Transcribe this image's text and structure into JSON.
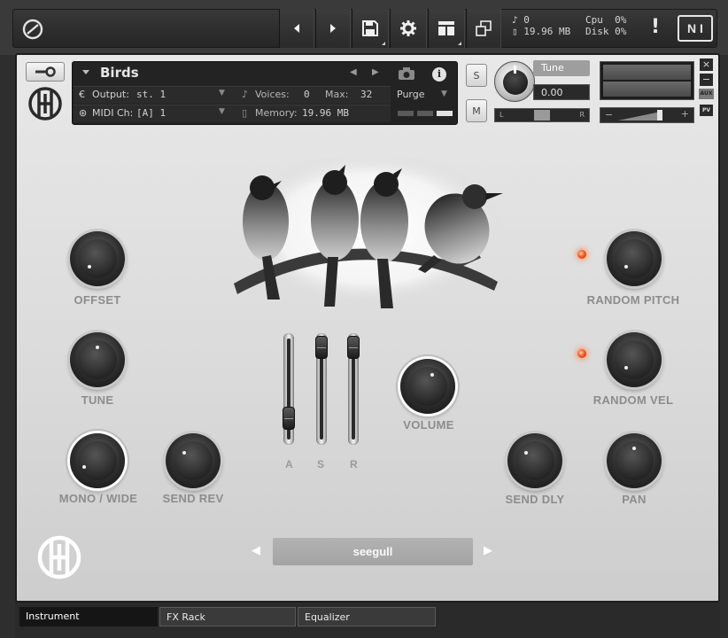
{
  "toolbar": {
    "logo_icon": "kontakt-logo-icon",
    "prev_icon": "triangle-left-icon",
    "next_icon": "triangle-right-icon",
    "voices": "0",
    "memory": "19.96 MB",
    "cpu_label": "Cpu",
    "cpu_value": "0%",
    "disk_label": "Disk",
    "disk_value": "0%",
    "warning": "!",
    "ni_logo": "N I"
  },
  "instrument": {
    "name": "Birds",
    "output_label": "Output:",
    "output_value": "st. 1",
    "voices_label": "Voices:",
    "voices_value": "0",
    "max_label": "Max:",
    "max_value": "32",
    "purge_label": "Purge",
    "midi_label": "MIDI Ch:",
    "midi_value": "[A]  1",
    "memory_label": "Memory:",
    "memory_value": "19.96 MB",
    "solo_label": "S",
    "mute_label": "M",
    "tune_label": "Tune",
    "tune_value": "0.00",
    "pan_left": "L",
    "pan_right": "R",
    "vol_minus": "−",
    "vol_plus": "+",
    "close_label": "×",
    "min_label": "−",
    "aux_label": "AUX",
    "pv_label": "PV"
  },
  "controls": {
    "offset": {
      "label": "OFFSET"
    },
    "tune": {
      "label": "TUNE"
    },
    "mono_wide": {
      "label": "MONO / WIDE"
    },
    "send_rev": {
      "label": "SEND REV"
    },
    "random_pitch": {
      "label": "RANDOM PITCH"
    },
    "random_vel": {
      "label": "RANDOM VEL"
    },
    "volume": {
      "label": "VOLUME"
    },
    "send_dly": {
      "label": "SEND DLY"
    },
    "pan": {
      "label": "PAN"
    }
  },
  "envelope": {
    "attack": {
      "label": "A",
      "level": 0.15
    },
    "sustain": {
      "label": "S",
      "level": 1.0
    },
    "release": {
      "label": "R",
      "level": 1.0
    }
  },
  "preset": {
    "name": "seegull",
    "prev": "◀",
    "next": "▶"
  },
  "tabs": [
    {
      "label": "Instrument"
    },
    {
      "label": "FX Rack"
    },
    {
      "label": "Equalizer"
    }
  ],
  "colors": {
    "led": "#ff5a1e",
    "panel": "#dadada",
    "label": "#8c8c8c"
  }
}
